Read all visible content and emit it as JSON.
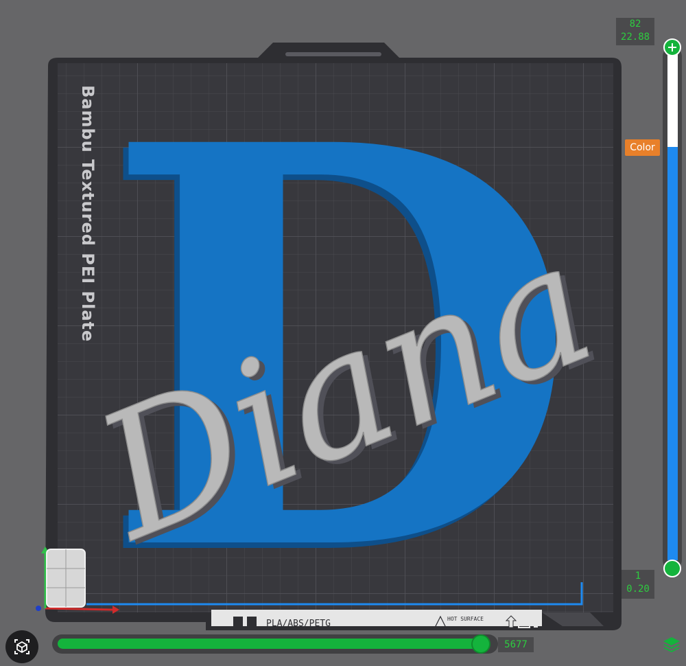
{
  "plate": {
    "name": "Bambu Textured PEI Plate",
    "filament_label": "PLA/ABS/PETG",
    "warning_label": "HOT SURFACE"
  },
  "model": {
    "letter": "D",
    "name_text": "Diana"
  },
  "layer_slider": {
    "top_layer": "82",
    "top_height": "22.88",
    "bottom_layer": "1",
    "bottom_height": "0.20",
    "color_tag": "Color"
  },
  "move_slider": {
    "value": "5677",
    "progress": 1.0
  },
  "colors": {
    "letter": "#1574c4",
    "script": "#b9b9b9",
    "slider_green": "#14b33c",
    "layer_blue": "#1e8af0",
    "color_tag": "#e8802a"
  },
  "icons": {
    "view": "cube-view-icon",
    "layers": "layers-icon"
  }
}
